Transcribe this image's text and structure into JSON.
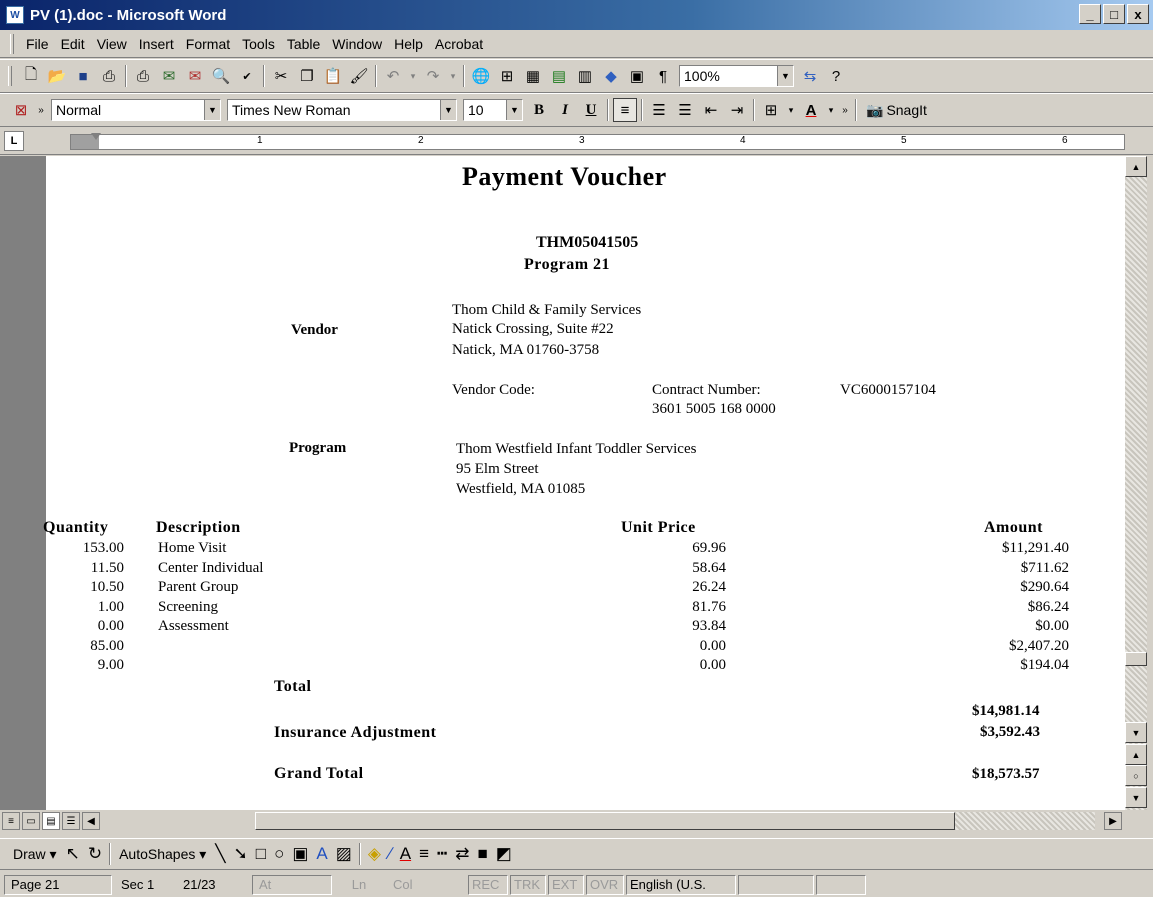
{
  "window": {
    "title": "PV (1).doc - Microsoft Word",
    "app_icon": "W",
    "minimize": "_",
    "maximize": "□",
    "close": "x"
  },
  "menu": [
    "File",
    "Edit",
    "View",
    "Insert",
    "Format",
    "Tools",
    "Table",
    "Window",
    "Help",
    "Acrobat"
  ],
  "toolbar": {
    "zoom": "100%",
    "style": "Normal",
    "font": "Times New Roman",
    "size": "10",
    "snagit": "SnagIt",
    "bold": "B",
    "italic": "I",
    "underline": "U",
    "pilcrow": "¶"
  },
  "ruler": {
    "corner": "L",
    "marks": [
      "1",
      "2",
      "3",
      "4",
      "5",
      "6"
    ]
  },
  "document": {
    "title": "Payment Voucher",
    "voucher_id": "THM05041505",
    "program_no": "Program 21",
    "vendor_label": "Vendor",
    "vendor_name": "Thom Child & Family Services",
    "vendor_addr1": "Natick Crossing, Suite #22",
    "vendor_addr2": "Natick, MA 01760-3758",
    "vendor_code_label": "Vendor Code:",
    "contract_label": "Contract Number:",
    "contract_value": "VC6000157104",
    "contract_number": "3601 5005 168 0000",
    "program_label": "Program",
    "program_name": "Thom Westfield Infant Toddler Services",
    "program_addr1": "95 Elm Street",
    "program_addr2": "Westfield, MA 01085",
    "headers": {
      "quantity": "Quantity",
      "description": "Description",
      "unit_price": "Unit Price",
      "amount": "Amount"
    },
    "rows": [
      {
        "qty": "153.00",
        "desc": "Home Visit",
        "price": "69.96",
        "amount": "$11,291.40"
      },
      {
        "qty": "11.50",
        "desc": "Center Individual",
        "price": "58.64",
        "amount": "$711.62"
      },
      {
        "qty": "10.50",
        "desc": "Parent Group",
        "price": "26.24",
        "amount": "$290.64"
      },
      {
        "qty": "1.00",
        "desc": "Screening",
        "price": "81.76",
        "amount": "$86.24"
      },
      {
        "qty": "0.00",
        "desc": "Assessment",
        "price": "93.84",
        "amount": "$0.00"
      },
      {
        "qty": "85.00",
        "desc": "",
        "price": "0.00",
        "amount": "$2,407.20"
      },
      {
        "qty": "9.00",
        "desc": "",
        "price": "0.00",
        "amount": "$194.04"
      }
    ],
    "total_label": "Total",
    "total_value": "$14,981.14",
    "insurance_label": "Insurance Adjustment",
    "insurance_value": "$3,592.43",
    "grand_label": "Grand Total",
    "grand_value": "$18,573.57"
  },
  "drawbar": {
    "draw": "Draw ▾",
    "autoshapes": "AutoShapes ▾"
  },
  "status": {
    "page": "Page 21",
    "sec": "Sec 1",
    "pages": "21/23",
    "at": "At",
    "ln": "Ln",
    "col": "Col",
    "rec": "REC",
    "trk": "TRK",
    "ext": "EXT",
    "ovr": "OVR",
    "lang": "English (U.S."
  }
}
